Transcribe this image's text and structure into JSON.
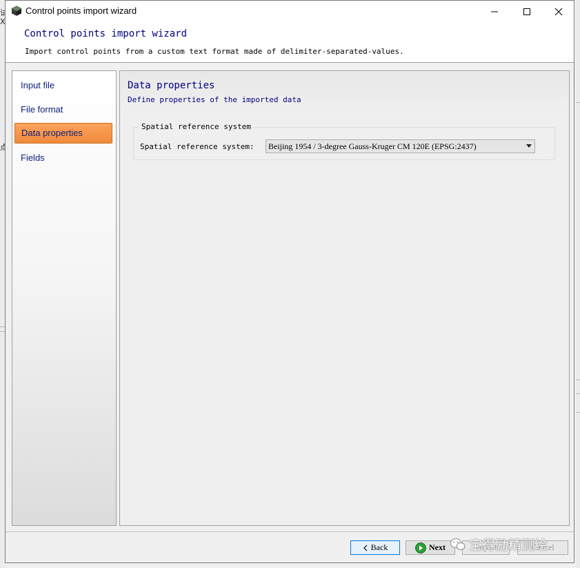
{
  "window": {
    "title": "Control points import wizard",
    "controls": {
      "minimize": "minimize",
      "maximize": "maximize",
      "close": "close"
    }
  },
  "header": {
    "title": "Control points import wizard",
    "subtitle": "Import control points from a custom text format made of delimiter-separated-values."
  },
  "steps": [
    {
      "label": "Input file",
      "active": false
    },
    {
      "label": "File format",
      "active": false
    },
    {
      "label": "Data properties",
      "active": true
    },
    {
      "label": "Fields",
      "active": false
    }
  ],
  "page": {
    "title": "Data properties",
    "subtitle": "Define properties of the imported data",
    "group": {
      "legend": "Spatial reference system",
      "srs_label": "Spatial reference system:",
      "srs_value": "Beijing 1954 / 3-degree Gauss-Kruger CM 120E (EPSG:2437)"
    }
  },
  "buttons": {
    "back": "Back",
    "next": "Next",
    "import": "Import",
    "cancel": "Cancel"
  },
  "background": {
    "left_glyphs": [
      "试",
      "X",
      "点"
    ]
  },
  "watermark": {
    "text": "宝得励精测绘"
  },
  "colors": {
    "accent_blue_text": "#000080",
    "active_step": "#f08a3c",
    "next_icon": "#2e9e3a"
  },
  "icons": {
    "app": "cube-icon",
    "back": "chevron-left-icon",
    "next": "arrow-right-circle-icon",
    "watermark": "wechat-icon"
  }
}
